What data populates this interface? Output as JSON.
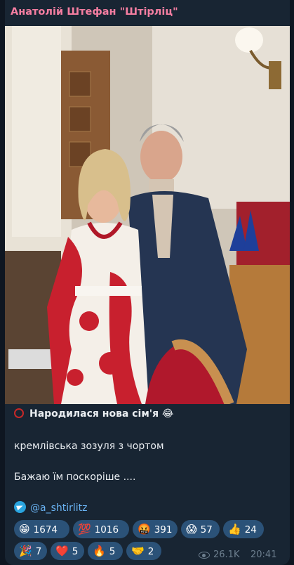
{
  "post": {
    "channel_name": "Анатолій Штефан \"Штірліц\"",
    "title": "Народилася нова сім'я 😂",
    "line2": "кремлівська зозуля з чортом",
    "line3": "Бажаю їм поскоріше ....",
    "handle": "@a_shtirlitz"
  },
  "reactions": [
    {
      "emoji": "😁",
      "count": "1674"
    },
    {
      "emoji": "💯",
      "count": "1016"
    },
    {
      "emoji": "🤬",
      "count": "391"
    },
    {
      "emoji": "😱",
      "count": "57"
    },
    {
      "emoji": "👍",
      "count": "24"
    },
    {
      "emoji": "🎉",
      "count": "7"
    },
    {
      "emoji": "❤️",
      "count": "5"
    },
    {
      "emoji": "🔥",
      "count": "5"
    },
    {
      "emoji": "🤝",
      "count": "2"
    }
  ],
  "meta": {
    "views": "26.1K",
    "time": "20:41"
  },
  "icons": {
    "views": "eye-icon",
    "channel_link": "telegram-icon",
    "title_marker": "spiral-icon"
  },
  "colors": {
    "background": "#0e1621",
    "bubble": "#182533",
    "channel_name": "#f57ea1",
    "link": "#6ab3f3",
    "reaction_pill": "#2b5278"
  }
}
